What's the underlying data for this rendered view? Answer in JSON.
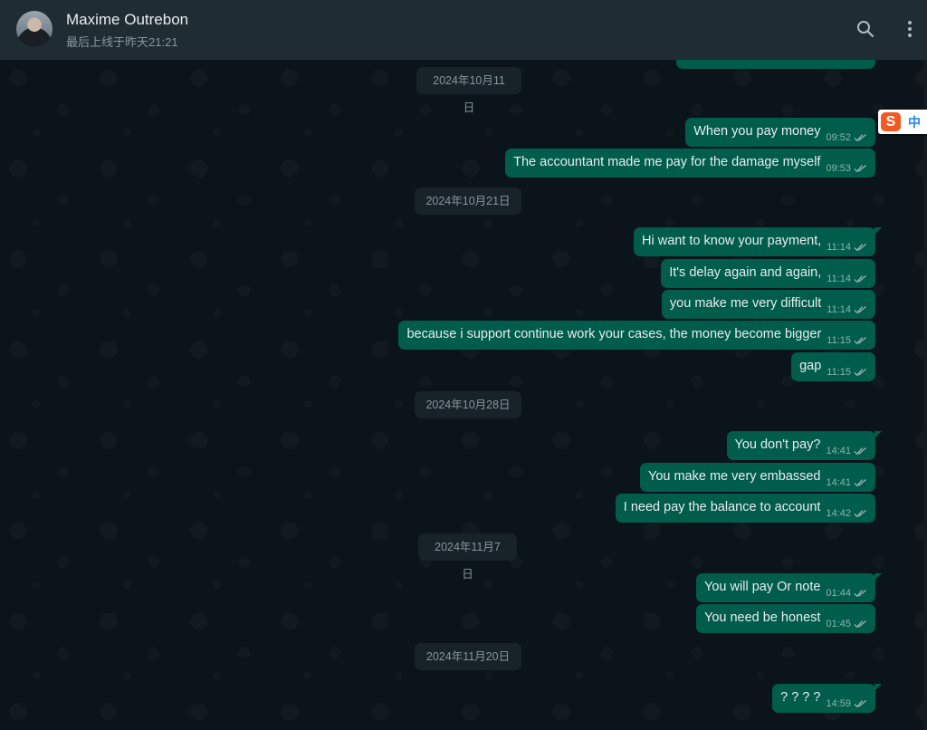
{
  "header": {
    "contact_name": "Maxime Outrebon",
    "last_seen": "最后上线于昨天21:21",
    "icons": [
      "search-icon",
      "menu-icon"
    ]
  },
  "ime": {
    "logo": "S",
    "lang": "中"
  },
  "dates": [
    "2024年10月11日",
    "2024年10月21日",
    "2024年10月28日",
    "2024年11月7日",
    "2024年11月20日"
  ],
  "messages": [
    {
      "text": "When you pay money",
      "time": "09:52",
      "status": "read"
    },
    {
      "text": "The accountant made me pay for the damage myself",
      "time": "09:53",
      "status": "read"
    },
    {
      "text": "Hi want to know your payment,",
      "time": "11:14",
      "status": "read"
    },
    {
      "text": "It's delay again and again,",
      "time": "11:14",
      "status": "read"
    },
    {
      "text": "you make me very difficult",
      "time": "11:14",
      "status": "read"
    },
    {
      "text": "because i support continue work your cases, the money become bigger",
      "time": "11:15",
      "status": "read"
    },
    {
      "text": "gap",
      "time": "11:15",
      "status": "read"
    },
    {
      "text": "You don't pay?",
      "time": "14:41",
      "status": "read"
    },
    {
      "text": "You make me very embassed",
      "time": "14:41",
      "status": "read"
    },
    {
      "text": "I need pay the balance to account",
      "time": "14:42",
      "status": "read"
    },
    {
      "text": "You will pay Or note",
      "time": "01:44",
      "status": "read"
    },
    {
      "text": "You need be honest",
      "time": "01:45",
      "status": "read"
    },
    {
      "text": "? ? ? ?",
      "time": "14:59",
      "status": "read"
    }
  ],
  "colors": {
    "chat_bg": "#0b141a",
    "header_bg": "#202c33",
    "outgoing_bubble": "#005c4b",
    "date_chip": "#182229",
    "text_primary": "#e9edef",
    "text_secondary": "#8696a0"
  }
}
